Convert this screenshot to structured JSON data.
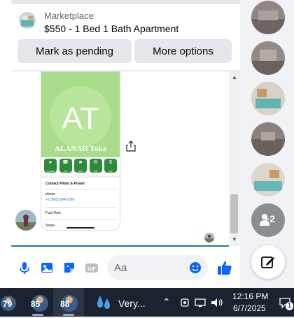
{
  "marketplace": {
    "label": "Marketplace",
    "listing_title": "$550 - 1 Bed 1 Bath Apartment"
  },
  "actions": {
    "mark_pending": "Mark as pending",
    "more_options": "More options"
  },
  "shared_contact": {
    "initials": "AT",
    "name": "ALANAH Toka",
    "action_labels": [
      "message",
      "call",
      "video",
      "mail",
      "pay"
    ],
    "contact_photo_label": "Contact Photo & Poster",
    "phone_label": "phone",
    "phone_number": "+1 (808) 994-5089",
    "facetime_label": "FaceTime",
    "notes_label": "Notes"
  },
  "composer": {
    "placeholder": "Aa",
    "icons": [
      "microphone-icon",
      "photo-icon",
      "sticker-icon",
      "gif-icon",
      "emoji-icon",
      "thumbs-up-icon"
    ],
    "gif_label": "GIF"
  },
  "right_rail": {
    "more_count": "+2",
    "avatar_count": 5
  },
  "taskbar": {
    "apps": [
      {
        "badge": "79"
      },
      {
        "badge": "85"
      },
      {
        "badge": "88"
      }
    ],
    "weather": "Very...",
    "time": "12:16 PM",
    "date": "6/7/2025",
    "notification_count": "1"
  },
  "colors": {
    "accent_blue": "#0866ff",
    "taskbar": "#1b2331",
    "contact_green": "#a8dc8a"
  }
}
